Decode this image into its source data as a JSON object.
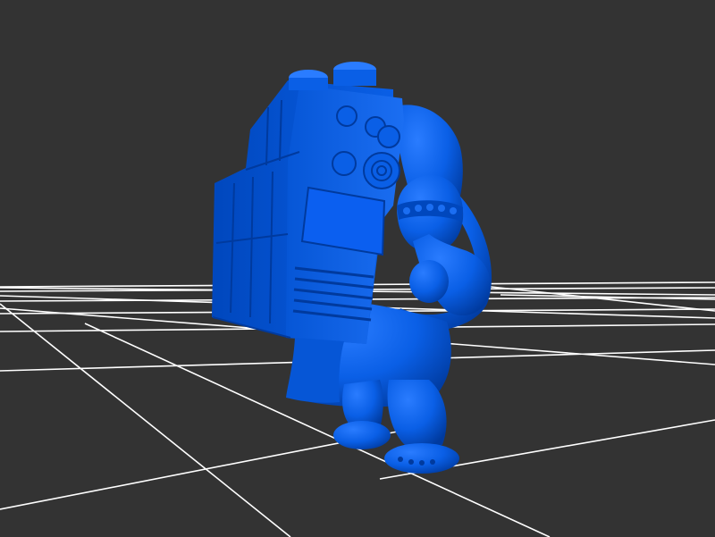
{
  "viewport": {
    "background_color": "#333333",
    "grid_color": "#ffffff",
    "model_color": "#0a5fe6"
  },
  "scene": {
    "objects": [
      {
        "type": "3d-model",
        "subject": "figure-with-large-backpack",
        "icon": "figure-model"
      },
      {
        "type": "floor-grid",
        "icon": "grid-plane"
      }
    ]
  }
}
